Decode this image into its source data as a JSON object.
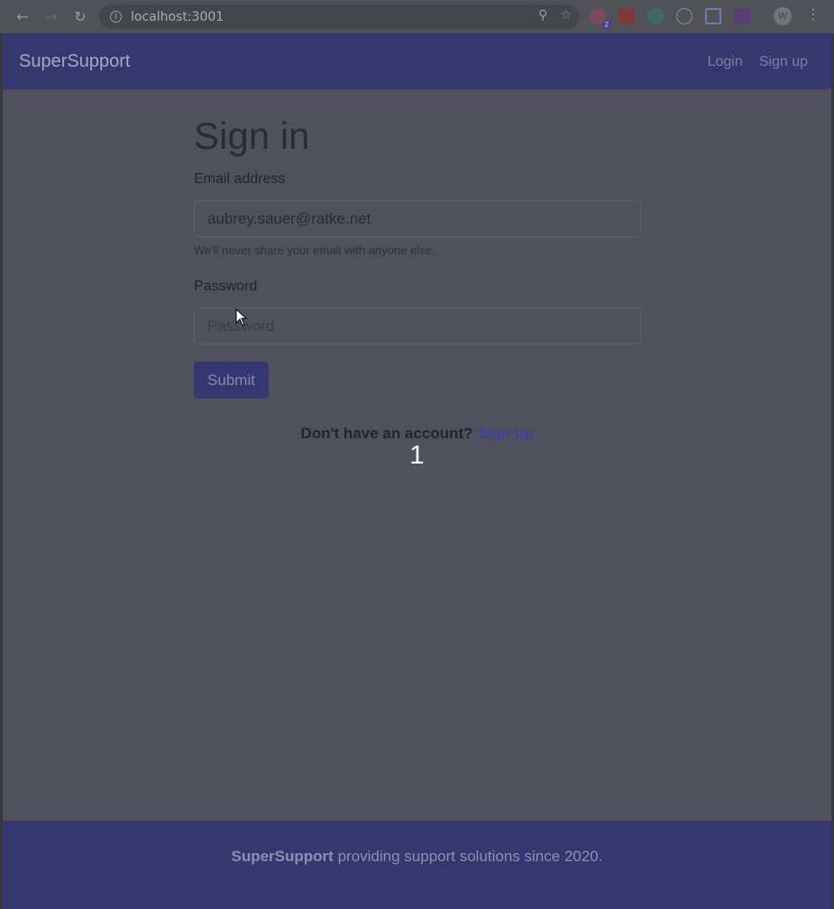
{
  "browser": {
    "url": "localhost:3001",
    "extension_badge": "2",
    "profile_initial": "W"
  },
  "navbar": {
    "brand": "SuperSupport",
    "login_label": "Login",
    "signup_label": "Sign up"
  },
  "form": {
    "title": "Sign in",
    "email_label": "Email address",
    "email_value": "aubrey.sauer@ratke.net",
    "email_help": "We'll never share your email with anyone else.",
    "password_label": "Password",
    "password_placeholder": "Password",
    "submit_label": "Submit"
  },
  "signup_prompt": {
    "text": "Don't have an account?",
    "link": "Sign up"
  },
  "step_number": "1",
  "footer": {
    "brand": "SuperSupport",
    "text": "providing support solutions since 2020."
  },
  "colors": {
    "navbar": "#353771",
    "page_bg": "#4f525c",
    "primary": "#353771"
  }
}
